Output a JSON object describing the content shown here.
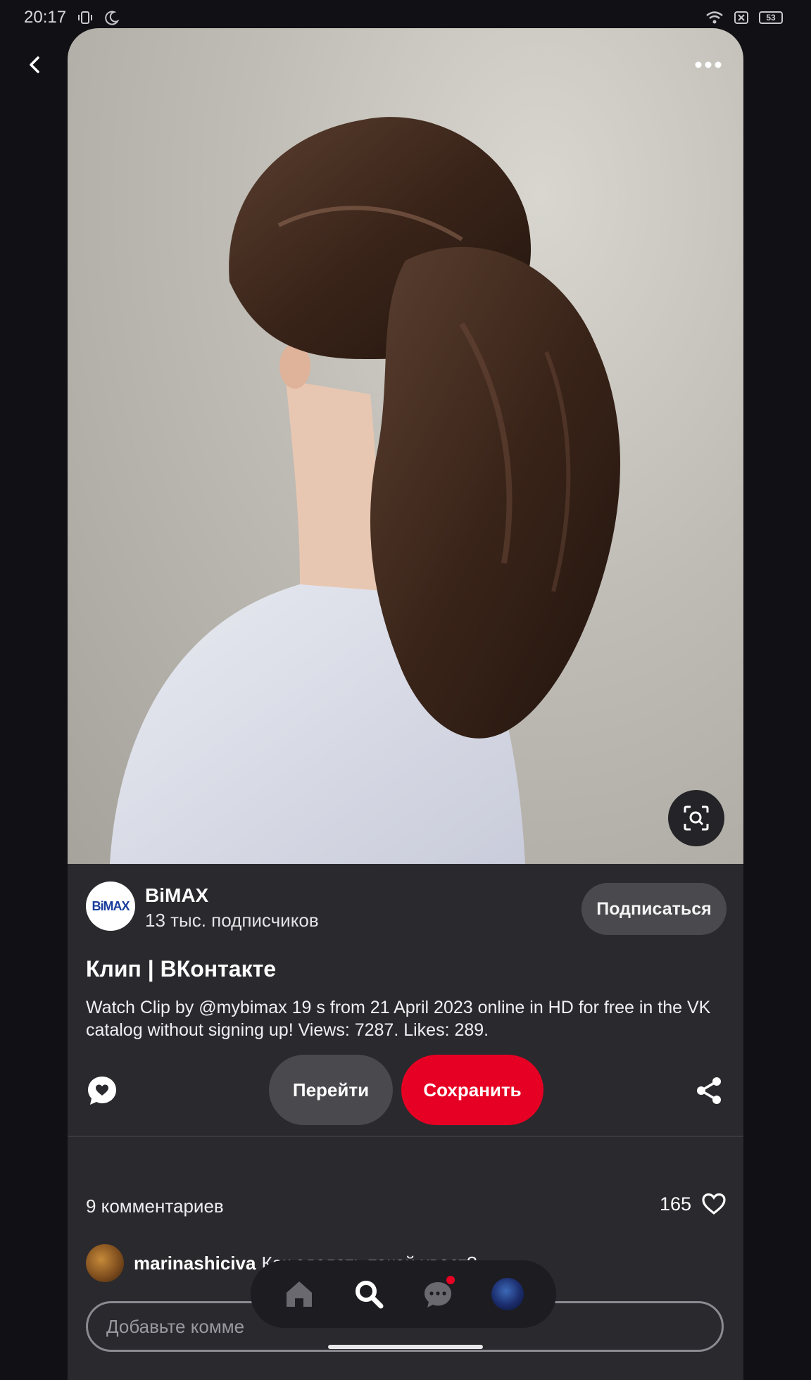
{
  "status_bar": {
    "time": "20:17",
    "battery": "53",
    "icons": [
      "vibrate-icon",
      "do-not-disturb-icon",
      "wifi-icon",
      "no-sim-icon",
      "battery-icon"
    ]
  },
  "header": {
    "back_icon": "chevron-left-icon",
    "more_icon": "more-horizontal-icon"
  },
  "pin": {
    "image_description": "woman-ponytail-hairstyle-photo",
    "lens_icon": "visual-search-icon"
  },
  "author": {
    "name": "BiMAX",
    "subscribers": "13 тыс. подписчиков",
    "logo_text": "BiMAX",
    "subscribe_label": "Подписаться"
  },
  "title": "Клип | ВКонтакте",
  "description": "Watch Clip by @mybimax 19 s from 21 April 2023 online in HD for free in the VK catalog without signing up! Views: 7287. Likes: 289.",
  "actions": {
    "goto_label": "Перейти",
    "save_label": "Сохранить"
  },
  "comments": {
    "count_label": "9 комментариев",
    "likes_count": "165",
    "items": [
      {
        "user": "marinashiciva",
        "text": "Как сделать такой хвост?"
      }
    ],
    "input_placeholder": "Добавьте комме"
  },
  "bottom_nav": {
    "items": [
      "home-icon",
      "search-icon",
      "messages-icon",
      "profile-avatar"
    ],
    "active": "search-icon"
  },
  "colors": {
    "accent": "#e60023",
    "background": "#111014",
    "card": "#2a292e",
    "button_secondary": "#4a494e"
  }
}
